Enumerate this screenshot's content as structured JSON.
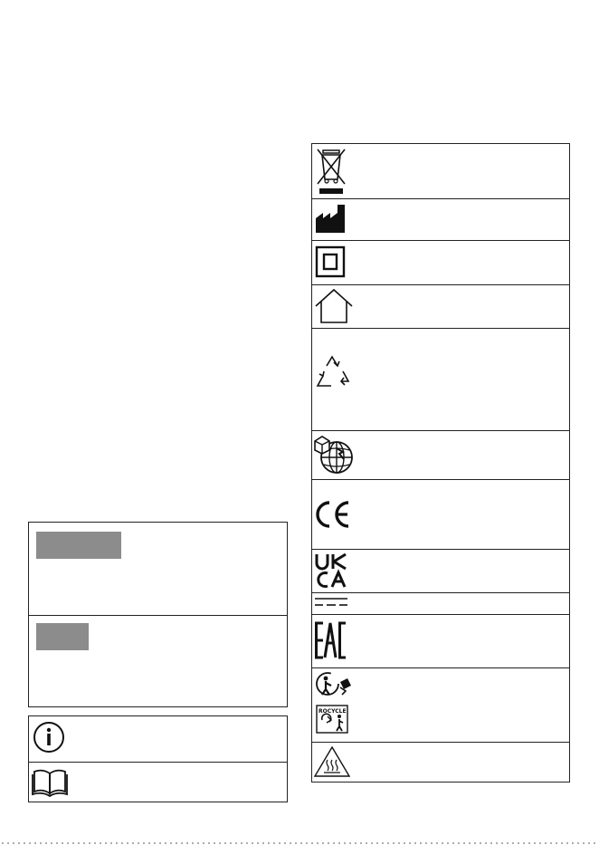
{
  "left_panel": {
    "warning_label_swatch_color": "#8c8c8c",
    "caution_label_swatch_color": "#8c8c8c"
  },
  "info_panel": {
    "icons": [
      "info-icon",
      "read-manual-icon"
    ]
  },
  "symbols_panel": {
    "icons": [
      "weee-crossed-bin-icon",
      "manufacturer-icon",
      "double-insulation-class-ii-icon",
      "indoor-use-icon",
      "recycling-triangle-icon",
      "worldwide-shipping-globe-icon",
      "ce-mark-icon",
      "ukca-mark-icon",
      "direct-current-icon",
      "eac-mark-icon",
      "tidyman-recycle-icon",
      "hot-surface-warning-icon"
    ]
  }
}
